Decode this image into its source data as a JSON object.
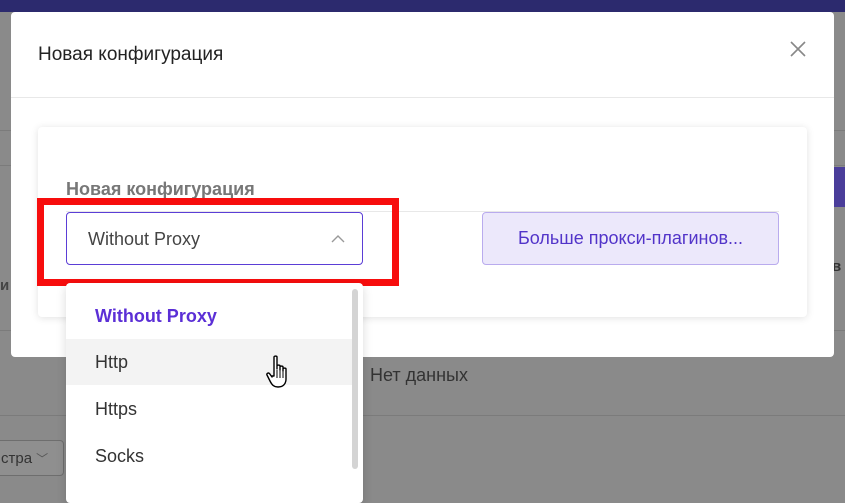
{
  "background": {
    "empty_text": "Нет данных",
    "pager_text": "стра",
    "right_fragment": "в",
    "left_fragment": "и"
  },
  "modal": {
    "title": "Новая конфигурация",
    "close_icon": "close-icon",
    "card": {
      "title": "Новая конфигурация",
      "proxy_select": {
        "value": "Without Proxy",
        "icon": "chevron-up-icon",
        "options": [
          "Without Proxy",
          "Http",
          "Https",
          "Socks"
        ],
        "selected_index": 0,
        "hovered_index": 1
      },
      "more_plugins_label": "Больше прокси-плагинов..."
    }
  },
  "colors": {
    "accent": "#5b2fd6",
    "highlight": "#f70d0d",
    "secondary_bg": "#ece8fb"
  }
}
